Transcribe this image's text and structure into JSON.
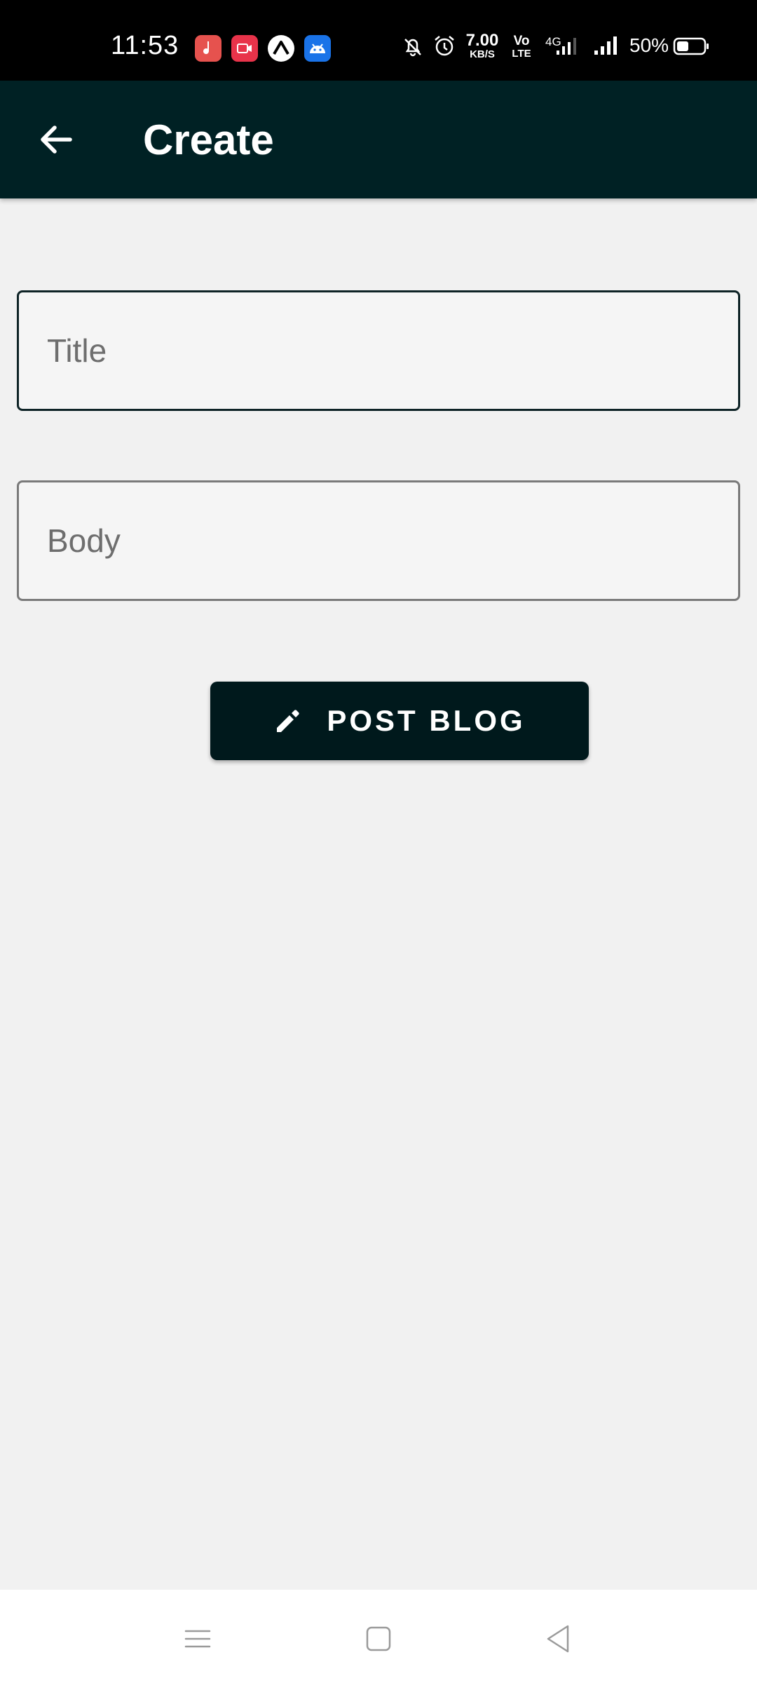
{
  "status_bar": {
    "time": "11:53",
    "net_speed_value": "7.00",
    "net_speed_unit": "KB/S",
    "volte_top": "Vo",
    "volte_bottom": "LTE",
    "network": "4G",
    "battery": "50%",
    "notif_icons": [
      "music-app-icon",
      "screen-recorder-icon",
      "expo-icon",
      "android-debug-icon"
    ]
  },
  "app_bar": {
    "title": "Create",
    "back_icon": "arrow-left-icon"
  },
  "form": {
    "title_placeholder": "Title",
    "title_value": "",
    "body_placeholder": "Body",
    "body_value": ""
  },
  "post_button": {
    "label": "POST BLOG",
    "icon": "pencil-icon"
  },
  "colors": {
    "app_bar": "#002124",
    "button": "#00191c",
    "background": "#f1f1f1",
    "focused_border": "#0e2326"
  }
}
